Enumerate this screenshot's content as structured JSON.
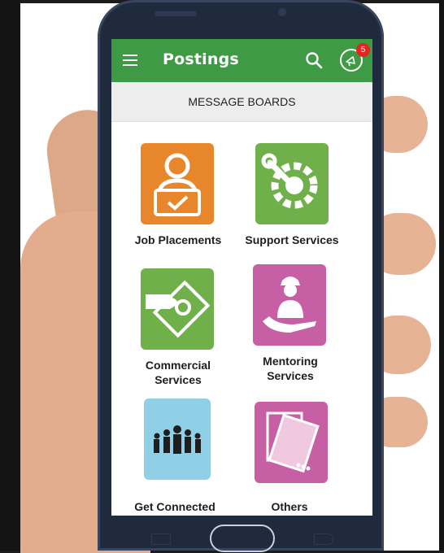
{
  "app": {
    "title": "Postings",
    "menu_icon": "hamburger-menu-icon",
    "search_icon": "search-icon",
    "notifications_icon": "megaphone-icon",
    "notification_count": "5",
    "accent_color": "#3f9a45",
    "badge_color": "#e32622"
  },
  "subheader": {
    "title": "MESSAGE BOARDS"
  },
  "tiles": [
    {
      "label": "Job Placements",
      "icon": "job-placements-icon",
      "color": "#e8862b"
    },
    {
      "label": "Support Services",
      "icon": "gear-wrench-icon",
      "color": "#6fb04a"
    },
    {
      "label": "Commercial Services",
      "label_line1": "Commercial",
      "label_line2": "Services",
      "icon": "commercial-card-icon",
      "color": "#6fb04a"
    },
    {
      "label": "Mentoring Services",
      "label_line1": "Mentoring",
      "label_line2": "Services",
      "icon": "mentor-icon",
      "color": "#c65fa3"
    },
    {
      "label": "Get Connected",
      "icon": "people-group-icon",
      "color": "#8fd0e6"
    },
    {
      "label": "Others",
      "icon": "documents-icon",
      "color": "#c65fa3"
    }
  ]
}
